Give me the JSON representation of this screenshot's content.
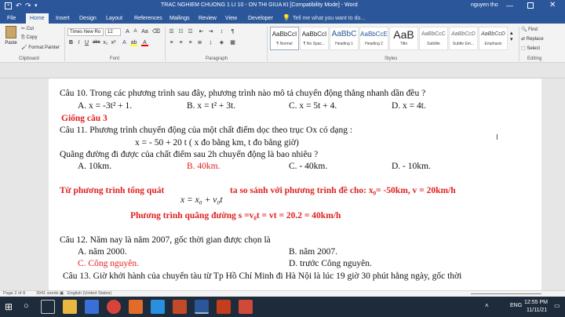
{
  "titlebar": {
    "title": "TRAC NGHIEM CHUONG 1 LI 10 - ON THI GIUA KI [Compatibility Mode] - Word",
    "user": "nguyen tho"
  },
  "tabs": [
    "File",
    "Home",
    "Insert",
    "Design",
    "Layout",
    "References",
    "Mailings",
    "Review",
    "View",
    "Developer"
  ],
  "tell_me": "Tell me what you want to do...",
  "ribbon": {
    "clipboard": {
      "paste": "Paste",
      "cut": "Cut",
      "copy": "Copy",
      "format_painter": "Format Painter",
      "label": "Clipboard"
    },
    "font": {
      "name": "Times New Ro",
      "size": "12",
      "label": "Font"
    },
    "paragraph": {
      "label": "Paragraph"
    },
    "styles": [
      {
        "preview": "AaBbCcI",
        "name": "¶ Normal"
      },
      {
        "preview": "AaBbCcI",
        "name": "¶ No Spac..."
      },
      {
        "preview": "AaBbC",
        "name": "Heading 1"
      },
      {
        "preview": "AaBbCcE",
        "name": "Heading 2"
      },
      {
        "preview": "AaB",
        "name": "Title"
      },
      {
        "preview": "AaBbCcC",
        "name": "Subtitle"
      },
      {
        "preview": "AaBbCcD",
        "name": "Subtle Em..."
      },
      {
        "preview": "AaBbCcD",
        "name": "Emphasis"
      }
    ],
    "styles_label": "Styles",
    "editing": {
      "find": "Find",
      "replace": "Replace",
      "select": "Select",
      "label": "Editing"
    }
  },
  "doc": {
    "q10": "Câu 10. Trong các phương trình sau đây, phương trình nào mô tả chuyển động thẳng nhanh dần đều ?",
    "q10a": "A. x = -3t² + 1.",
    "q10b": "B. x = t² + 3t.",
    "q10c": "C. x = 5t + 4.",
    "q10d": "D. x = 4t.",
    "same": "Giống câu 3",
    "q11": "Câu 11. Phương trình chuyển động của một chất điểm dọc theo trục Ox có dạng :",
    "q11eq": "x = - 50 + 20 t ( x đo bằng km, t đo bằng giờ)",
    "q11b_line": "Quãng đường đi được của chất điểm sau 2h chuyển động là bao nhiêu ?",
    "q11a": "A. 10km.",
    "q11bb": "B. 40km.",
    "q11c": "C. - 40km.",
    "q11d": "D. - 10km.",
    "expl1a": "Từ phương trình tổng quát",
    "formula": "x = x₀ + v₀t",
    "expl1b": "ta so sánh với phương trình đề cho: x₀= -50km, v = 20km/h",
    "expl2": "Phương trình quãng đường s =v₀t = vt = 20.2 = 40km/h",
    "q12": "Câu 12. Năm nay là năm 2007, gốc thời gian được chọn là",
    "q12a": "A. năm 2000.",
    "q12b": "B. năm 2007.",
    "q12c": "C. Công nguyên.",
    "q12d": "D. trước Công nguyên.",
    "q13": "Câu 13. Giờ khởi hành của chuyến tàu từ Tp Hồ Chí Minh đi Hà Nội là lúc 19 giờ 30 phút hằng ngày, gốc thời"
  },
  "status": {
    "page": "Page 2 of 8",
    "words": "3941 words",
    "lang": "English (United States)"
  },
  "taskbar": {
    "lang": "ENG",
    "time": "12:55 PM",
    "date": "11/11/21"
  }
}
